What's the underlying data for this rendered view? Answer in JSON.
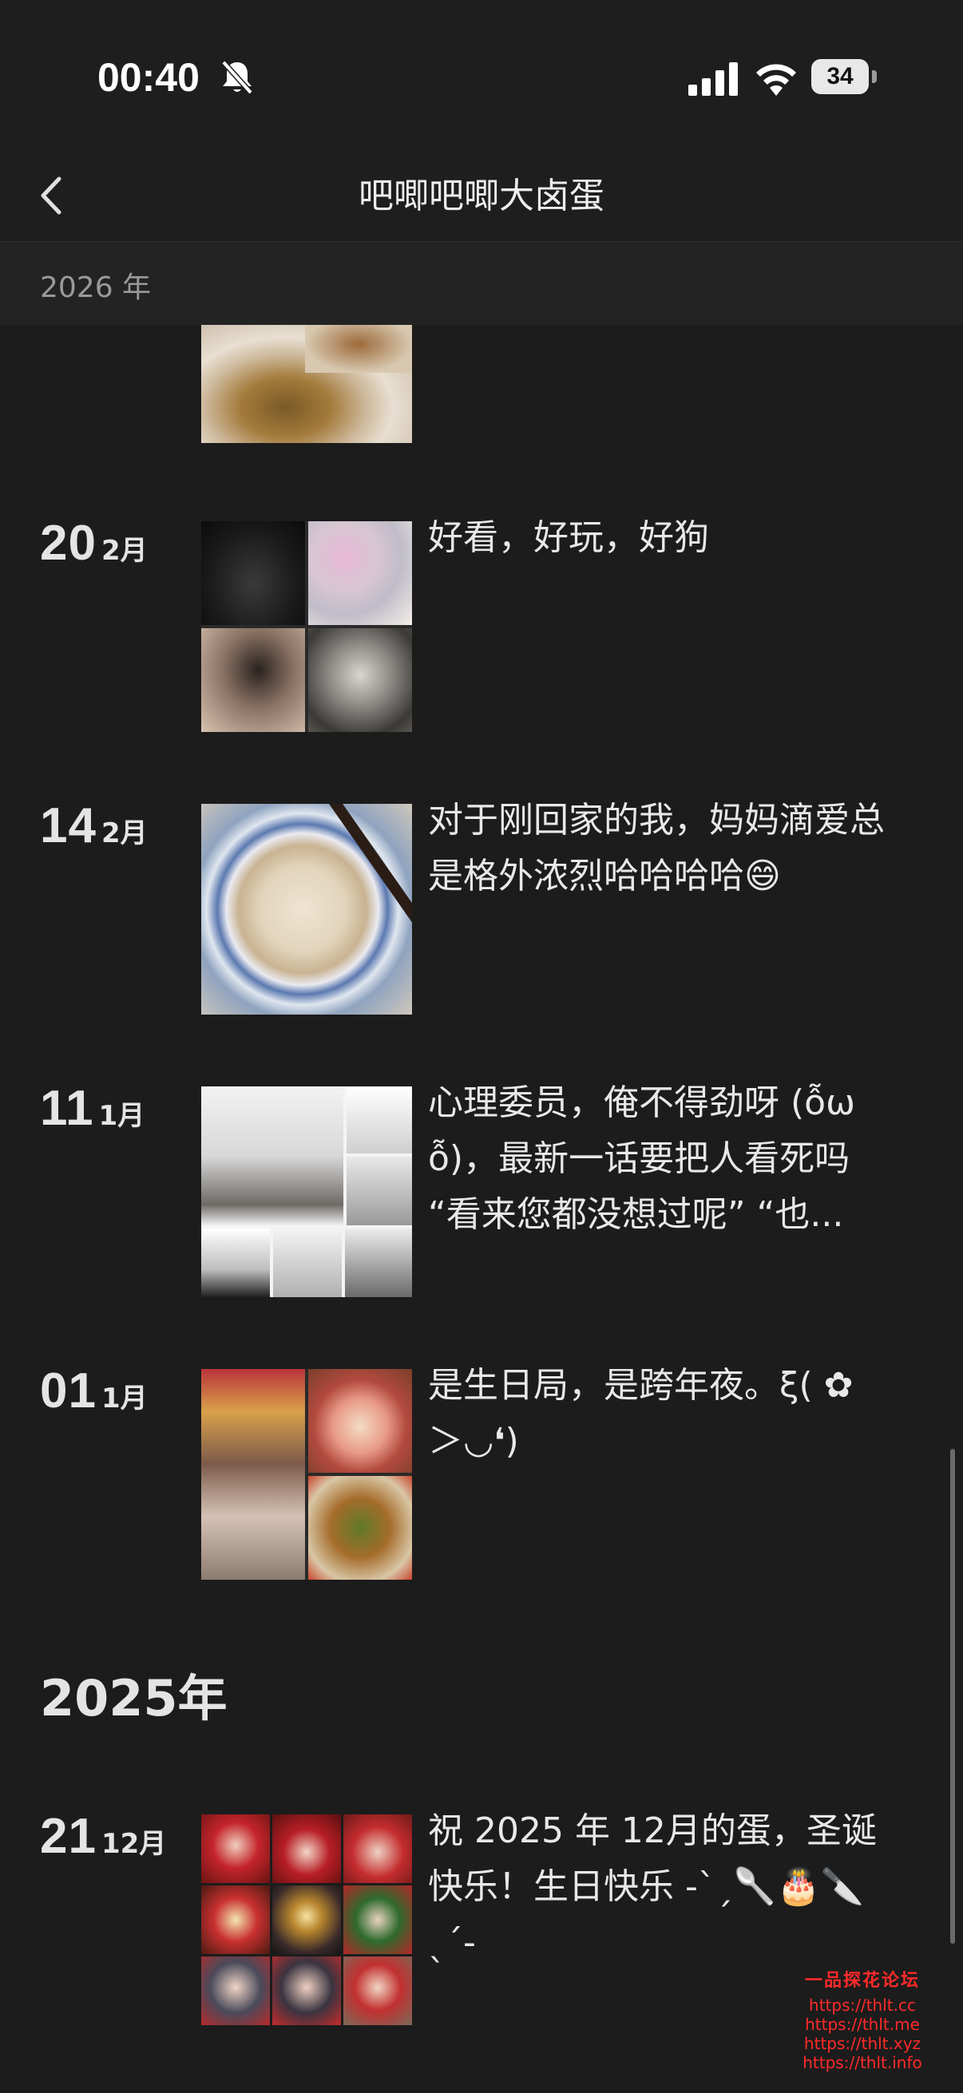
{
  "status_bar": {
    "time": "00:40",
    "battery": "34"
  },
  "nav": {
    "title": "吧唧吧唧大卤蛋"
  },
  "sticky_year": "2026 年",
  "entries": [
    {
      "day": "20",
      "month": "2月",
      "text": "好看，好玩，好狗"
    },
    {
      "day": "14",
      "month": "2月",
      "text": "对于刚回家的我，妈妈滴爱总是格外浓烈哈哈哈哈😄"
    },
    {
      "day": "11",
      "month": "1月",
      "text": "心理委员，俺不得劲呀 (ỗω ỗ)，最新一话要把人看死吗 “看来您都没想过呢” “也..."
    },
    {
      "day": "01",
      "month": "1月",
      "text": "是生日局，是跨年夜。ξ( ✿ ＞◡❛)"
    },
    {
      "day": "21",
      "month": "12月",
      "text": "祝 2025 年 12月的蛋，圣诞快乐！生日快乐 -ˋˏ🥄🎂🔪ˎˊ-"
    }
  ],
  "year_heading": "2025年",
  "watermark": {
    "title": "一品探花论坛",
    "links": [
      "https://thlt.cc",
      "https://thlt.me",
      "https://thlt.xyz",
      "https://thlt.info"
    ]
  },
  "colors": {
    "background": "#1c1c1c",
    "bar": "#1e1e1e",
    "text": "#e6e6e6",
    "muted": "#9a9a9a",
    "watermark": "#ff2a2a"
  },
  "icons": [
    "bell-slash-icon",
    "signal-icon",
    "wifi-icon",
    "battery-icon",
    "chevron-left-icon"
  ]
}
